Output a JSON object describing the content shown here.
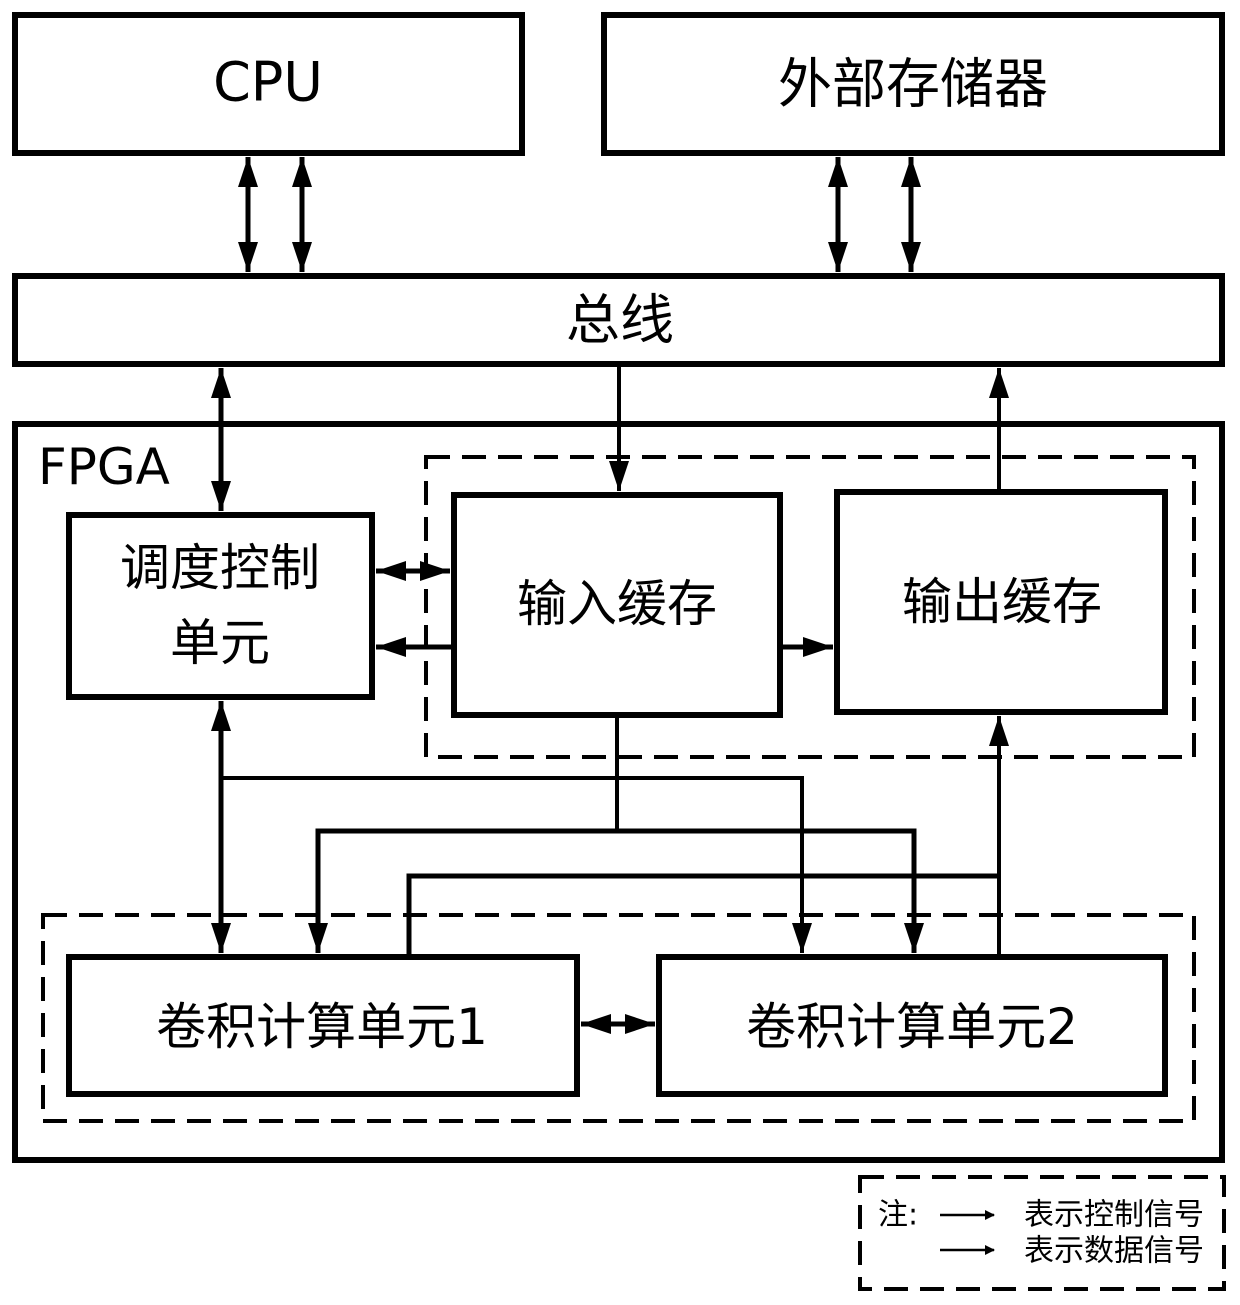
{
  "diagram": {
    "nodes": {
      "cpu": "CPU",
      "external_memory": "外部存储器",
      "bus": "总线",
      "fpga": "FPGA",
      "scheduler_line1": "调度控制",
      "scheduler_line2": "单元",
      "input_buffer": "输入缓存",
      "output_buffer": "输出缓存",
      "conv_unit_1": "卷积计算单元1",
      "conv_unit_2": "卷积计算单元2"
    },
    "groups": {
      "buffer_group": "dashed group: input buffer + output buffer",
      "compute_group": "dashed group: conv unit 1 + conv unit 2"
    },
    "legend": {
      "note_label": "注:",
      "control_signal": "表示控制信号",
      "data_signal": "表示数据信号"
    },
    "edges": [
      {
        "from": "cpu",
        "to": "bus",
        "type": "bidirectional"
      },
      {
        "from": "cpu",
        "to": "bus",
        "type": "bidirectional"
      },
      {
        "from": "external_memory",
        "to": "bus",
        "type": "bidirectional"
      },
      {
        "from": "external_memory",
        "to": "bus",
        "type": "bidirectional"
      },
      {
        "from": "bus",
        "to": "scheduler",
        "type": "bidirectional"
      },
      {
        "from": "bus",
        "to": "input_buffer",
        "type": "directed"
      },
      {
        "from": "output_buffer",
        "to": "bus",
        "type": "directed"
      },
      {
        "from": "scheduler",
        "to": "input_buffer",
        "type": "bidirectional"
      },
      {
        "from": "input_buffer",
        "to": "scheduler",
        "type": "directed"
      },
      {
        "from": "input_buffer",
        "to": "output_buffer",
        "type": "directed"
      },
      {
        "from": "scheduler",
        "to": "conv_unit_1",
        "type": "bidirectional"
      },
      {
        "from": "scheduler",
        "to": "conv_unit_2",
        "type": "directed"
      },
      {
        "from": "input_buffer",
        "to": "conv_unit_1",
        "type": "directed"
      },
      {
        "from": "input_buffer",
        "to": "conv_unit_2",
        "type": "directed"
      },
      {
        "from": "conv_unit_1",
        "to": "output_buffer",
        "type": "directed"
      },
      {
        "from": "conv_unit_2",
        "to": "output_buffer",
        "type": "directed"
      },
      {
        "from": "conv_unit_1",
        "to": "conv_unit_2",
        "type": "bidirectional"
      }
    ]
  }
}
